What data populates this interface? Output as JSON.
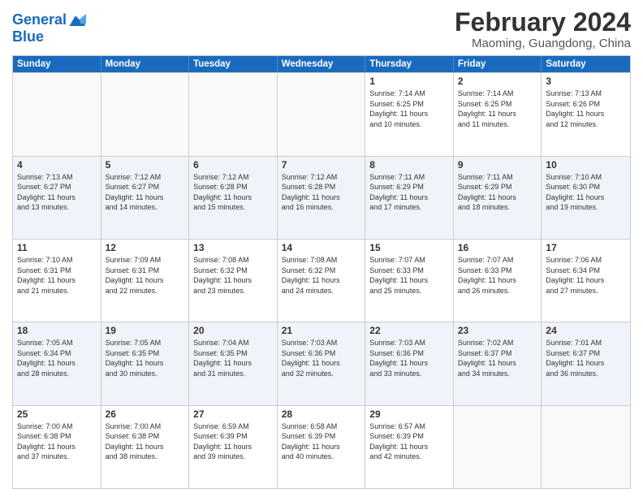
{
  "logo": {
    "line1": "General",
    "line2": "Blue"
  },
  "title": {
    "month_year": "February 2024",
    "location": "Maoming, Guangdong, China"
  },
  "days_of_week": [
    "Sunday",
    "Monday",
    "Tuesday",
    "Wednesday",
    "Thursday",
    "Friday",
    "Saturday"
  ],
  "weeks": [
    {
      "alt": false,
      "cells": [
        {
          "day": "",
          "detail": ""
        },
        {
          "day": "",
          "detail": ""
        },
        {
          "day": "",
          "detail": ""
        },
        {
          "day": "",
          "detail": ""
        },
        {
          "day": "1",
          "detail": "Sunrise: 7:14 AM\nSunset: 6:25 PM\nDaylight: 11 hours\nand 10 minutes."
        },
        {
          "day": "2",
          "detail": "Sunrise: 7:14 AM\nSunset: 6:25 PM\nDaylight: 11 hours\nand 11 minutes."
        },
        {
          "day": "3",
          "detail": "Sunrise: 7:13 AM\nSunset: 6:26 PM\nDaylight: 11 hours\nand 12 minutes."
        }
      ]
    },
    {
      "alt": true,
      "cells": [
        {
          "day": "4",
          "detail": "Sunrise: 7:13 AM\nSunset: 6:27 PM\nDaylight: 11 hours\nand 13 minutes."
        },
        {
          "day": "5",
          "detail": "Sunrise: 7:12 AM\nSunset: 6:27 PM\nDaylight: 11 hours\nand 14 minutes."
        },
        {
          "day": "6",
          "detail": "Sunrise: 7:12 AM\nSunset: 6:28 PM\nDaylight: 11 hours\nand 15 minutes."
        },
        {
          "day": "7",
          "detail": "Sunrise: 7:12 AM\nSunset: 6:28 PM\nDaylight: 11 hours\nand 16 minutes."
        },
        {
          "day": "8",
          "detail": "Sunrise: 7:11 AM\nSunset: 6:29 PM\nDaylight: 11 hours\nand 17 minutes."
        },
        {
          "day": "9",
          "detail": "Sunrise: 7:11 AM\nSunset: 6:29 PM\nDaylight: 11 hours\nand 18 minutes."
        },
        {
          "day": "10",
          "detail": "Sunrise: 7:10 AM\nSunset: 6:30 PM\nDaylight: 11 hours\nand 19 minutes."
        }
      ]
    },
    {
      "alt": false,
      "cells": [
        {
          "day": "11",
          "detail": "Sunrise: 7:10 AM\nSunset: 6:31 PM\nDaylight: 11 hours\nand 21 minutes."
        },
        {
          "day": "12",
          "detail": "Sunrise: 7:09 AM\nSunset: 6:31 PM\nDaylight: 11 hours\nand 22 minutes."
        },
        {
          "day": "13",
          "detail": "Sunrise: 7:08 AM\nSunset: 6:32 PM\nDaylight: 11 hours\nand 23 minutes."
        },
        {
          "day": "14",
          "detail": "Sunrise: 7:08 AM\nSunset: 6:32 PM\nDaylight: 11 hours\nand 24 minutes."
        },
        {
          "day": "15",
          "detail": "Sunrise: 7:07 AM\nSunset: 6:33 PM\nDaylight: 11 hours\nand 25 minutes."
        },
        {
          "day": "16",
          "detail": "Sunrise: 7:07 AM\nSunset: 6:33 PM\nDaylight: 11 hours\nand 26 minutes."
        },
        {
          "day": "17",
          "detail": "Sunrise: 7:06 AM\nSunset: 6:34 PM\nDaylight: 11 hours\nand 27 minutes."
        }
      ]
    },
    {
      "alt": true,
      "cells": [
        {
          "day": "18",
          "detail": "Sunrise: 7:05 AM\nSunset: 6:34 PM\nDaylight: 11 hours\nand 28 minutes."
        },
        {
          "day": "19",
          "detail": "Sunrise: 7:05 AM\nSunset: 6:35 PM\nDaylight: 11 hours\nand 30 minutes."
        },
        {
          "day": "20",
          "detail": "Sunrise: 7:04 AM\nSunset: 6:35 PM\nDaylight: 11 hours\nand 31 minutes."
        },
        {
          "day": "21",
          "detail": "Sunrise: 7:03 AM\nSunset: 6:36 PM\nDaylight: 11 hours\nand 32 minutes."
        },
        {
          "day": "22",
          "detail": "Sunrise: 7:03 AM\nSunset: 6:36 PM\nDaylight: 11 hours\nand 33 minutes."
        },
        {
          "day": "23",
          "detail": "Sunrise: 7:02 AM\nSunset: 6:37 PM\nDaylight: 11 hours\nand 34 minutes."
        },
        {
          "day": "24",
          "detail": "Sunrise: 7:01 AM\nSunset: 6:37 PM\nDaylight: 11 hours\nand 36 minutes."
        }
      ]
    },
    {
      "alt": false,
      "cells": [
        {
          "day": "25",
          "detail": "Sunrise: 7:00 AM\nSunset: 6:38 PM\nDaylight: 11 hours\nand 37 minutes."
        },
        {
          "day": "26",
          "detail": "Sunrise: 7:00 AM\nSunset: 6:38 PM\nDaylight: 11 hours\nand 38 minutes."
        },
        {
          "day": "27",
          "detail": "Sunrise: 6:59 AM\nSunset: 6:39 PM\nDaylight: 11 hours\nand 39 minutes."
        },
        {
          "day": "28",
          "detail": "Sunrise: 6:58 AM\nSunset: 6:39 PM\nDaylight: 11 hours\nand 40 minutes."
        },
        {
          "day": "29",
          "detail": "Sunrise: 6:57 AM\nSunset: 6:39 PM\nDaylight: 11 hours\nand 42 minutes."
        },
        {
          "day": "",
          "detail": ""
        },
        {
          "day": "",
          "detail": ""
        }
      ]
    }
  ]
}
